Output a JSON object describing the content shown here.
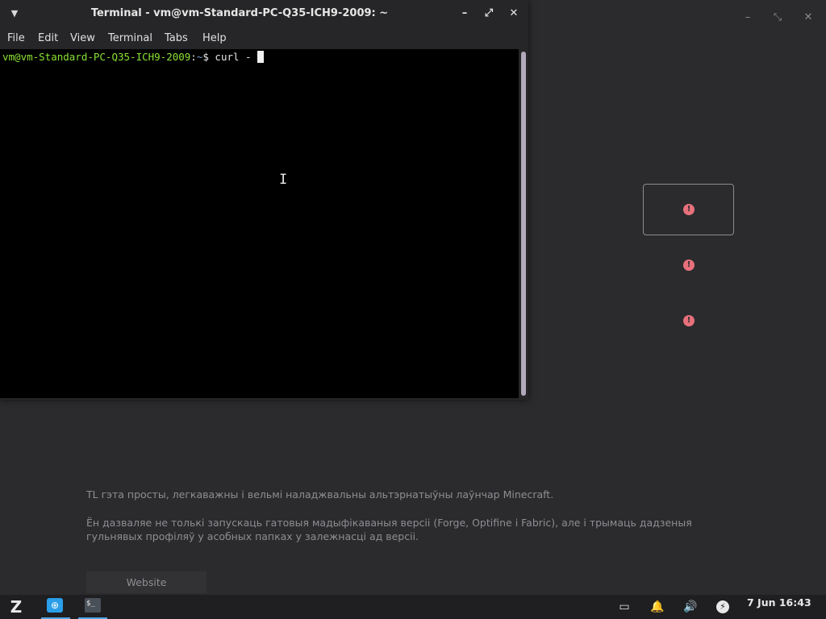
{
  "background_app": {
    "window_controls": {
      "minimize": "–",
      "maximize": "⤡",
      "close": "✕"
    },
    "error_icon_glyph": "!",
    "description": {
      "paragraph1": "TL гэта просты, легкаважны і вельмі наладжвальны альтэрнатыўны лаўнчар Minecraft.",
      "paragraph2_line1": "Ён дазваляе не толькі запускаць гатовыя мадыфікаваныя версіі (Forge, Optifine і Fabric), але і трымаць дадзеныя",
      "paragraph2_line2": "гульнявых профіляў у асобных папках у залежнасці ад версіі."
    },
    "website_button": "Website",
    "colors": {
      "error": "#e8707b",
      "background": "#2b2b2e"
    }
  },
  "terminal": {
    "title": "Terminal - vm@vm-Standard-PC-Q35-ICH9-2009: ~",
    "menu_toggle": "▼",
    "window_controls": {
      "minimize": "–",
      "maximize": "⤢",
      "close": "✕"
    },
    "menu": [
      "File",
      "Edit",
      "View",
      "Terminal",
      "Tabs",
      "Help"
    ],
    "prompt": {
      "user_host": "vm@vm-Standard-PC-Q35-ICH9-2009",
      "separator": ":",
      "path": "~",
      "symbol": "$ ",
      "command": "curl - "
    },
    "mouse_cursor": "I",
    "colors": {
      "user_host": "#8ae234",
      "path": "#729fcf"
    }
  },
  "taskbar": {
    "zorin_menu": "Z",
    "apps": [
      {
        "name": "Software",
        "glyph": "⊕",
        "active": true
      },
      {
        "name": "Terminal",
        "glyph": "$_",
        "active": true
      }
    ],
    "tray": {
      "display": "▭",
      "bell": "🔔",
      "volume": "🔊",
      "power": "⚡"
    },
    "clock": "7 Jun 16:43"
  }
}
